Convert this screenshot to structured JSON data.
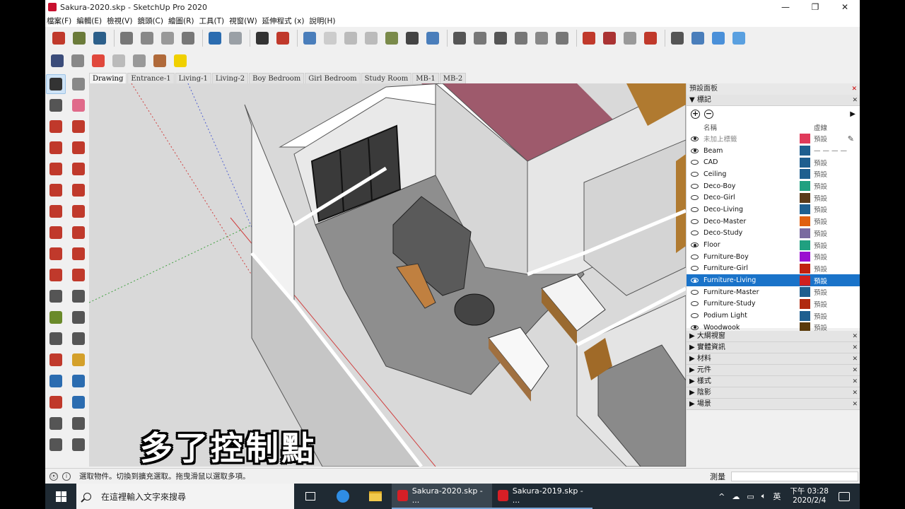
{
  "window": {
    "title": "Sakura-2020.skp - SketchUp Pro 2020",
    "controls": {
      "minimize": "—",
      "maximize": "❐",
      "close": "✕"
    }
  },
  "menu": [
    "檔案(F)",
    "編輯(E)",
    "檢視(V)",
    "鏡頭(C)",
    "繪圖(R)",
    "工具(T)",
    "視窗(W)",
    "延伸程式 (x)",
    "說明(H)"
  ],
  "toolbar": {
    "top": [
      {
        "icon": "new-file-icon",
        "color": "#c0392b"
      },
      {
        "icon": "open-folder-icon",
        "color": "#6b7b3a"
      },
      {
        "icon": "save-icon",
        "color": "#2c5f8a"
      },
      {
        "icon": "cut-icon",
        "color": "#777777"
      },
      {
        "icon": "copy-icon",
        "color": "#888888"
      },
      {
        "icon": "paste-icon",
        "color": "#999999"
      },
      {
        "icon": "erase-icon",
        "color": "#777777"
      },
      {
        "icon": "undo-icon",
        "color": "#2b6cb0"
      },
      {
        "icon": "redo-icon",
        "color": "#9aa0a6"
      },
      {
        "icon": "print-icon",
        "color": "#333333"
      },
      {
        "icon": "model-info-icon",
        "color": "#c0392b"
      },
      {
        "icon": "iso-view-icon",
        "color": "#4a7ebb"
      },
      {
        "icon": "top-view-icon",
        "color": "#cccccc"
      },
      {
        "icon": "front-view-icon",
        "color": "#bbbbbb"
      },
      {
        "icon": "right-view-icon",
        "color": "#bbbbbb"
      },
      {
        "icon": "back-view-icon",
        "color": "#7a8a4a"
      },
      {
        "icon": "xray-icon",
        "color": "#444444"
      },
      {
        "icon": "shaded-icon",
        "color": "#4a7ebb"
      },
      {
        "icon": "warehouse-icon",
        "color": "#555555"
      },
      {
        "icon": "door-icon",
        "color": "#777777"
      },
      {
        "icon": "house-icon",
        "color": "#555555"
      },
      {
        "icon": "house-roof-icon",
        "color": "#777777"
      },
      {
        "icon": "house-outline-icon",
        "color": "#888888"
      },
      {
        "icon": "house-section-icon",
        "color": "#777777"
      },
      {
        "icon": "ruby-gem-icon",
        "color": "#c0392b"
      },
      {
        "icon": "extension-warehouse-icon",
        "color": "#a33"
      },
      {
        "icon": "extension-manager-icon",
        "color": "#999999"
      },
      {
        "icon": "ruby-console-icon",
        "color": "#c0392b"
      },
      {
        "icon": "crosshair-icon",
        "color": "#555555"
      },
      {
        "icon": "section-plane-icon",
        "color": "#4a7ebb"
      },
      {
        "icon": "cube-blue-icon",
        "color": "#4a90d9"
      },
      {
        "icon": "cube-light-icon",
        "color": "#5aa0e0"
      }
    ],
    "second": [
      {
        "icon": "styles-icon",
        "color": "#3b4c7a"
      },
      {
        "icon": "trash-icon",
        "color": "#888888"
      },
      {
        "icon": "materials-icon",
        "color": "#e0483c"
      },
      {
        "icon": "gear-icon",
        "color": "#bbbbbb"
      },
      {
        "icon": "wrench-icon",
        "color": "#999999"
      },
      {
        "icon": "component-icon",
        "color": "#b06a3a"
      },
      {
        "icon": "lightbulb-icon",
        "color": "#f0d000"
      }
    ]
  },
  "palette": [
    {
      "icon": "select-arrow-icon",
      "color": "#333333",
      "active": true
    },
    {
      "icon": "make-component-icon",
      "color": "#888888"
    },
    {
      "icon": "paint-bucket-icon",
      "color": "#555555"
    },
    {
      "icon": "eraser-icon",
      "color": "#e06a8a"
    },
    {
      "icon": "line-tool-icon",
      "color": "#c0392b"
    },
    {
      "icon": "freehand-icon",
      "color": "#c0392b"
    },
    {
      "icon": "rectangle-icon",
      "color": "#c0392b"
    },
    {
      "icon": "rotated-rectangle-icon",
      "color": "#c0392b"
    },
    {
      "icon": "circle-icon",
      "color": "#c0392b"
    },
    {
      "icon": "polygon-icon",
      "color": "#c0392b"
    },
    {
      "icon": "arc-icon",
      "color": "#c0392b"
    },
    {
      "icon": "two-point-arc-icon",
      "color": "#c0392b"
    },
    {
      "icon": "three-point-arc-icon",
      "color": "#c0392b"
    },
    {
      "icon": "pie-icon",
      "color": "#c0392b"
    },
    {
      "icon": "move-icon",
      "color": "#c0392b"
    },
    {
      "icon": "push-pull-icon",
      "color": "#c0392b"
    },
    {
      "icon": "rotate-icon",
      "color": "#c0392b"
    },
    {
      "icon": "follow-me-icon",
      "color": "#c0392b"
    },
    {
      "icon": "scale-icon",
      "color": "#c0392b"
    },
    {
      "icon": "offset-icon",
      "color": "#c0392b"
    },
    {
      "icon": "tape-measure-icon",
      "color": "#555555"
    },
    {
      "icon": "dimension-icon",
      "color": "#555555"
    },
    {
      "icon": "protractor-icon",
      "color": "#6a8a2a"
    },
    {
      "icon": "text-tool-icon",
      "color": "#555555"
    },
    {
      "icon": "axes-icon",
      "color": "#555555"
    },
    {
      "icon": "3d-text-icon",
      "color": "#555555"
    },
    {
      "icon": "orbit-icon",
      "color": "#c0392b"
    },
    {
      "icon": "pan-hand-icon",
      "color": "#d4a02a"
    },
    {
      "icon": "zoom-icon",
      "color": "#2b6cb0"
    },
    {
      "icon": "zoom-window-icon",
      "color": "#2b6cb0"
    },
    {
      "icon": "zoom-extents-icon",
      "color": "#c0392b"
    },
    {
      "icon": "previous-view-icon",
      "color": "#2b6cb0"
    },
    {
      "icon": "position-camera-icon",
      "color": "#555555"
    },
    {
      "icon": "look-around-icon",
      "color": "#555555"
    },
    {
      "icon": "walk-icon",
      "color": "#555555"
    },
    {
      "icon": "section-tool-icon",
      "color": "#555555"
    }
  ],
  "scenes": [
    "Drawing",
    "Entrance-1",
    "Living-1",
    "Living-2",
    "Boy Bedroom",
    "Girl Bedroom",
    "Study Room",
    "MB-1",
    "MB-2"
  ],
  "active_scene": "Drawing",
  "caption": "多了控制點",
  "panel": {
    "title": "預設面板",
    "tags": {
      "header": "標記",
      "col_name": "名稱",
      "col_dash": "虛線",
      "add": "+",
      "remove": "−",
      "rows": [
        {
          "name": "未加上標籤",
          "visible": true,
          "color": "#e03a5a",
          "dash": "預設",
          "muted": true
        },
        {
          "name": "Beam",
          "visible": true,
          "color": "#1f5f8f",
          "dash": "— — — —"
        },
        {
          "name": "CAD",
          "visible": false,
          "color": "#1f5f8f",
          "dash": "預設"
        },
        {
          "name": "Ceiling",
          "visible": false,
          "color": "#1f5f8f",
          "dash": "預設"
        },
        {
          "name": "Deco-Boy",
          "visible": false,
          "color": "#20a080",
          "dash": "預設"
        },
        {
          "name": "Deco-Girl",
          "visible": false,
          "color": "#5a3a1a",
          "dash": "預設"
        },
        {
          "name": "Deco-Living",
          "visible": false,
          "color": "#1f5f8f",
          "dash": "預設"
        },
        {
          "name": "Deco-Master",
          "visible": false,
          "color": "#e06010",
          "dash": "預設"
        },
        {
          "name": "Deco-Study",
          "visible": false,
          "color": "#7a6aa0",
          "dash": "預設"
        },
        {
          "name": "Floor",
          "visible": true,
          "color": "#20a080",
          "dash": "預設"
        },
        {
          "name": "Furniture-Boy",
          "visible": false,
          "color": "#9a10d0",
          "dash": "預設"
        },
        {
          "name": "Furniture-Girl",
          "visible": false,
          "color": "#c02010",
          "dash": "預設"
        },
        {
          "name": "Furniture-Living",
          "visible": true,
          "color": "#d02020",
          "dash": "預設",
          "selected": true
        },
        {
          "name": "Furniture-Master",
          "visible": false,
          "color": "#1f5f8f",
          "dash": "預設"
        },
        {
          "name": "Furniture-Study",
          "visible": false,
          "color": "#b02a10",
          "dash": "預設"
        },
        {
          "name": "Podium Light",
          "visible": false,
          "color": "#1f5f8f",
          "dash": "預設"
        },
        {
          "name": "Woodwook",
          "visible": true,
          "color": "#5a3a0a",
          "dash": "預設"
        }
      ]
    },
    "trays": [
      "大綱視窗",
      "實體資訊",
      "材料",
      "元件",
      "樣式",
      "陰影",
      "場景"
    ]
  },
  "status": {
    "message": "選取物件。切換到擴充選取。拖曳滑鼠以選取多項。",
    "measure_label": "測量",
    "icons": [
      "geo-location-icon",
      "credits-icon"
    ]
  },
  "taskbar": {
    "search_placeholder": "在這裡輸入文字來搜尋",
    "apps": [
      {
        "label": "Sakura-2020.skp - ...",
        "active": true
      },
      {
        "label": "Sakura-2019.skp - ...",
        "active": false
      }
    ],
    "tray": {
      "chevron": "^",
      "ime": "英",
      "time": "下午 03:28",
      "date": "2020/2/4"
    }
  }
}
